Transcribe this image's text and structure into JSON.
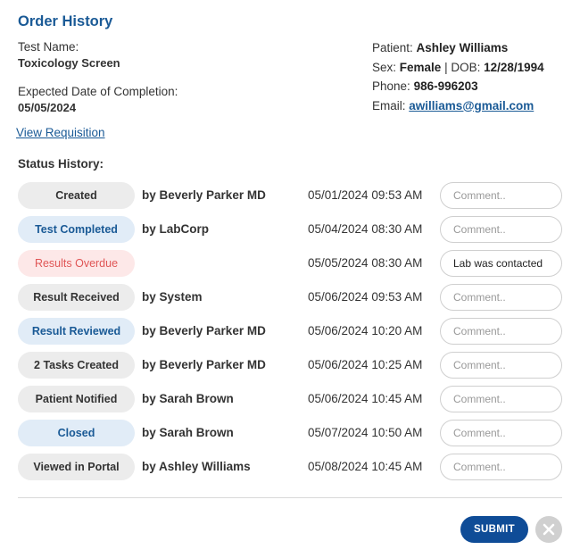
{
  "header": {
    "title": "Order History"
  },
  "test": {
    "name_label": "Test Name:",
    "name_value": "Toxicology Screen",
    "expected_label": "Expected Date of Completion:",
    "expected_value": "05/05/2024",
    "requisition_link": "View Requisition"
  },
  "patient": {
    "patient_label": "Patient:",
    "name": "Ashley Williams",
    "sex_label": "Sex:",
    "sex": "Female",
    "sep": " | ",
    "dob_label": "DOB:",
    "dob": "12/28/1994",
    "phone_label": "Phone:",
    "phone": "986-996203",
    "email_label": "Email:",
    "email": "awilliams@gmail.com"
  },
  "status_history": {
    "heading": "Status History:",
    "comment_placeholder": "Comment..",
    "rows": [
      {
        "status": "Created",
        "style": "grey",
        "by": "by Beverly Parker MD",
        "datetime": "05/01/2024 09:53 AM",
        "comment": ""
      },
      {
        "status": "Test Completed",
        "style": "blue",
        "by": "by LabCorp",
        "datetime": "05/04/2024 08:30 AM",
        "comment": ""
      },
      {
        "status": "Results Overdue",
        "style": "red",
        "by": "",
        "datetime": "05/05/2024 08:30 AM",
        "comment": "Lab was contacted"
      },
      {
        "status": "Result Received",
        "style": "grey",
        "by": "by System",
        "datetime": "05/06/2024 09:53 AM",
        "comment": ""
      },
      {
        "status": "Result Reviewed",
        "style": "blue",
        "by": "by Beverly Parker MD",
        "datetime": "05/06/2024 10:20 AM",
        "comment": ""
      },
      {
        "status": "2 Tasks Created",
        "style": "grey",
        "by": "by Beverly Parker MD",
        "datetime": "05/06/2024 10:25 AM",
        "comment": ""
      },
      {
        "status": "Patient Notified",
        "style": "grey",
        "by": "by Sarah Brown",
        "datetime": "05/06/2024 10:45 AM",
        "comment": ""
      },
      {
        "status": "Closed",
        "style": "blue",
        "by": "by Sarah Brown",
        "datetime": "05/07/2024 10:50 AM",
        "comment": ""
      },
      {
        "status": "Viewed in Portal",
        "style": "grey",
        "by": "by Ashley Williams",
        "datetime": "05/08/2024 10:45 AM",
        "comment": ""
      }
    ]
  },
  "actions": {
    "submit_label": "SUBMIT",
    "close_icon": "close-icon"
  },
  "colors": {
    "accent": "#1a5a96",
    "submit_bg": "#0f4c97",
    "pill_grey": "#ececec",
    "pill_blue": "#e1ecf7",
    "pill_red_bg": "#fde8e8",
    "pill_red_text": "#e05656"
  }
}
